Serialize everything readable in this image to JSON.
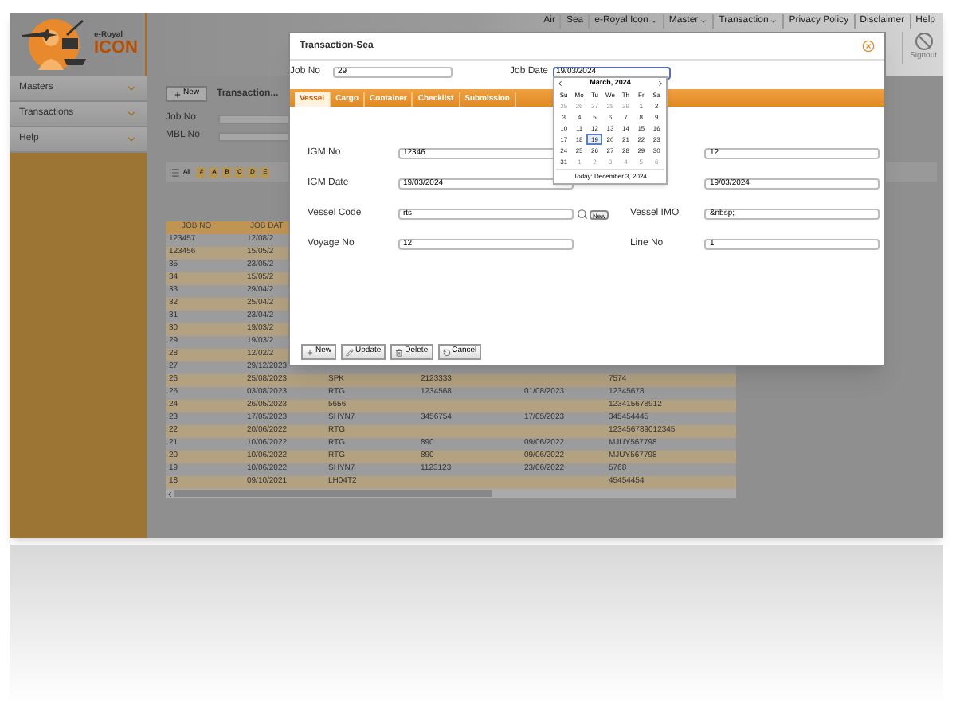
{
  "header": {
    "logo_small": "e-Royal",
    "logo_big": "ICON",
    "nav": [
      {
        "label": "Air",
        "dropdown": false
      },
      {
        "label": "Sea",
        "dropdown": false
      },
      {
        "label": "e-Royal Icon",
        "dropdown": true
      },
      {
        "label": "Master",
        "dropdown": true
      },
      {
        "label": "Transaction",
        "dropdown": true
      },
      {
        "label": "Privacy Policy",
        "dropdown": false
      },
      {
        "label": "Disclaimer",
        "dropdown": false
      },
      {
        "label": "Help",
        "dropdown": false
      }
    ],
    "signout": "Signout"
  },
  "sidebar": {
    "items": [
      "Masters",
      "Transactions",
      "Help"
    ]
  },
  "toolbar": {
    "new_button": "New",
    "tab": "Transaction..."
  },
  "filter": {
    "fields": [
      "Job No",
      "MBL No"
    ]
  },
  "alphabet": {
    "all": "All",
    "letters": [
      "#",
      "A",
      "B",
      "C",
      "D",
      "E"
    ]
  },
  "table": {
    "columns": [
      "JOB NO",
      "JOB DAT"
    ],
    "rows": [
      {
        "cells": [
          "123457",
          "12/08/2"
        ]
      },
      {
        "cells": [
          "123456",
          "15/05/2"
        ]
      },
      {
        "cells": [
          "35",
          "23/05/2"
        ]
      },
      {
        "cells": [
          "34",
          "15/05/2"
        ]
      },
      {
        "cells": [
          "33",
          "29/04/2"
        ]
      },
      {
        "cells": [
          "32",
          "25/04/2"
        ]
      },
      {
        "cells": [
          "31",
          "23/04/2"
        ]
      },
      {
        "cells": [
          "30",
          "19/03/2"
        ]
      },
      {
        "cells": [
          "29",
          "19/03/2"
        ]
      },
      {
        "cells": [
          "28",
          "12/02/2"
        ]
      },
      {
        "cells": [
          "27",
          "29/12/2023"
        ]
      },
      {
        "cells": [
          "26",
          "25/08/2023",
          "SPK",
          "2123333",
          "",
          "7574"
        ]
      },
      {
        "cells": [
          "25",
          "03/08/2023",
          "RTG",
          "1234568",
          "01/08/2023",
          "12345678"
        ]
      },
      {
        "cells": [
          "24",
          "26/05/2023",
          "5656",
          "",
          "",
          "123415678912"
        ]
      },
      {
        "cells": [
          "23",
          "17/05/2023",
          "SHYN7",
          "3456754",
          "17/05/2023",
          "345454445"
        ]
      },
      {
        "cells": [
          "22",
          "20/06/2022",
          "RTG",
          "",
          "",
          "123456789012345"
        ]
      },
      {
        "cells": [
          "21",
          "10/06/2022",
          "RTG",
          "890",
          "09/06/2022",
          "MJUY567798"
        ]
      },
      {
        "cells": [
          "20",
          "10/06/2022",
          "RTG",
          "890",
          "09/06/2022",
          "MJUY567798"
        ]
      },
      {
        "cells": [
          "19",
          "10/06/2022",
          "SHYN7",
          "1123123",
          "23/06/2022",
          "5768"
        ]
      },
      {
        "cells": [
          "18",
          "09/10/2021",
          "LH04T2",
          "",
          "",
          "45454454"
        ]
      }
    ]
  },
  "modal": {
    "title": "Transaction-Sea",
    "job_no": {
      "label": "Job No",
      "value": "29"
    },
    "job_date": {
      "label": "Job Date",
      "value": "19/03/2024"
    },
    "tabs": [
      {
        "label": "Vessel",
        "selected": true
      },
      {
        "label": "Cargo",
        "selected": false
      },
      {
        "label": "Container",
        "selected": false
      },
      {
        "label": "Checklist",
        "selected": false
      },
      {
        "label": "Submission",
        "selected": false
      }
    ],
    "rows": [
      [
        {
          "kind": "text",
          "label": "IGM No",
          "value": "12346"
        },
        {
          "kind": "text",
          "value": "12"
        }
      ],
      [
        {
          "kind": "text",
          "label": "IGM Date",
          "value": "19/03/2024"
        },
        {
          "kind": "text",
          "value": "19/03/2024"
        }
      ],
      [
        {
          "kind": "lookup",
          "label": "Vessel Code",
          "value": "rts",
          "new_button": "New"
        },
        {
          "kind": "text",
          "label": "Vessel IMO",
          "value": "&nbsp;"
        }
      ],
      [
        {
          "kind": "text",
          "label": "Voyage No",
          "value": "12"
        },
        {
          "kind": "text",
          "label": "Line No",
          "value": "1"
        }
      ]
    ],
    "buttons": [
      "New",
      "Update",
      "Delete",
      "Cancel"
    ],
    "calendar": {
      "title": "March, 2024",
      "weekdays": [
        "Su",
        "Mo",
        "Tu",
        "We",
        "Th",
        "Fr",
        "Sa"
      ],
      "days": [
        {
          "label": "25",
          "outside": true,
          "selected": false
        },
        {
          "label": "26",
          "outside": true,
          "selected": false
        },
        {
          "label": "27",
          "outside": true,
          "selected": false
        },
        {
          "label": "28",
          "outside": true,
          "selected": false
        },
        {
          "label": "29",
          "outside": true,
          "selected": false
        },
        {
          "label": "1",
          "outside": false,
          "selected": false
        },
        {
          "label": "2",
          "outside": false,
          "selected": false
        },
        {
          "label": "3",
          "outside": false,
          "selected": false
        },
        {
          "label": "4",
          "outside": false,
          "selected": false
        },
        {
          "label": "5",
          "outside": false,
          "selected": false
        },
        {
          "label": "6",
          "outside": false,
          "selected": false
        },
        {
          "label": "7",
          "outside": false,
          "selected": false
        },
        {
          "label": "8",
          "outside": false,
          "selected": false
        },
        {
          "label": "9",
          "outside": false,
          "selected": false
        },
        {
          "label": "10",
          "outside": false,
          "selected": false
        },
        {
          "label": "11",
          "outside": false,
          "selected": false
        },
        {
          "label": "12",
          "outside": false,
          "selected": false
        },
        {
          "label": "13",
          "outside": false,
          "selected": false
        },
        {
          "label": "14",
          "outside": false,
          "selected": false
        },
        {
          "label": "15",
          "outside": false,
          "selected": false
        },
        {
          "label": "16",
          "outside": false,
          "selected": false
        },
        {
          "label": "17",
          "outside": false,
          "selected": false
        },
        {
          "label": "18",
          "outside": false,
          "selected": false
        },
        {
          "label": "19",
          "outside": false,
          "selected": true
        },
        {
          "label": "20",
          "outside": false,
          "selected": false
        },
        {
          "label": "21",
          "outside": false,
          "selected": false
        },
        {
          "label": "22",
          "outside": false,
          "selected": false
        },
        {
          "label": "23",
          "outside": false,
          "selected": false
        },
        {
          "label": "24",
          "outside": false,
          "selected": false
        },
        {
          "label": "25",
          "outside": false,
          "selected": false
        },
        {
          "label": "26",
          "outside": false,
          "selected": false
        },
        {
          "label": "27",
          "outside": false,
          "selected": false
        },
        {
          "label": "28",
          "outside": false,
          "selected": false
        },
        {
          "label": "29",
          "outside": false,
          "selected": false
        },
        {
          "label": "30",
          "outside": false,
          "selected": false
        },
        {
          "label": "31",
          "outside": false,
          "selected": false
        },
        {
          "label": "1",
          "outside": true,
          "selected": false
        },
        {
          "label": "2",
          "outside": true,
          "selected": false
        },
        {
          "label": "3",
          "outside": true,
          "selected": false
        },
        {
          "label": "4",
          "outside": true,
          "selected": false
        },
        {
          "label": "5",
          "outside": true,
          "selected": false
        },
        {
          "label": "6",
          "outside": true,
          "selected": false
        }
      ],
      "today": "Today: December 3, 2024"
    }
  }
}
